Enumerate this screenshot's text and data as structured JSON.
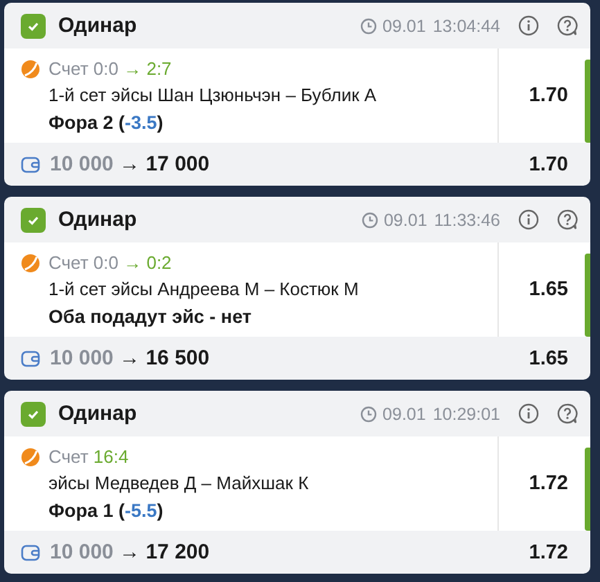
{
  "bets": [
    {
      "type": "Одинар",
      "won": true,
      "date": "09.01",
      "time": "13:04:44",
      "score": {
        "label": "Счет",
        "start": "0:0",
        "arrow": "→",
        "current": "2:7"
      },
      "event": "1-й сет эйсы Шан Цзюньчэн – Бублик А",
      "bet_prefix": "Фора 2 (",
      "handicap": "-3.5",
      "bet_suffix": ")",
      "odds": "1.70",
      "stake": "10 000",
      "stake_arrow": "→",
      "payout": "17 000",
      "total_odds": "1.70"
    },
    {
      "type": "Одинар",
      "won": true,
      "date": "09.01",
      "time": "11:33:46",
      "score": {
        "label": "Счет",
        "start": "0:0",
        "arrow": "→",
        "current": "0:2"
      },
      "event": "1-й сет эйсы Андреева М – Костюк М",
      "bet_prefix": "Оба подадут эйс - нет",
      "odds": "1.65",
      "stake": "10 000",
      "stake_arrow": "→",
      "payout": "16 500",
      "total_odds": "1.65"
    },
    {
      "type": "Одинар",
      "won": true,
      "date": "09.01",
      "time": "10:29:01",
      "score": {
        "label": "Счет",
        "current": "16:4"
      },
      "event": "эйсы Медведев Д – Майхшак К",
      "bet_prefix": "Фора 1 (",
      "handicap": "-5.5",
      "bet_suffix": ")",
      "odds": "1.72",
      "stake": "10 000",
      "stake_arrow": "→",
      "payout": "17 200",
      "total_odds": "1.72"
    }
  ]
}
